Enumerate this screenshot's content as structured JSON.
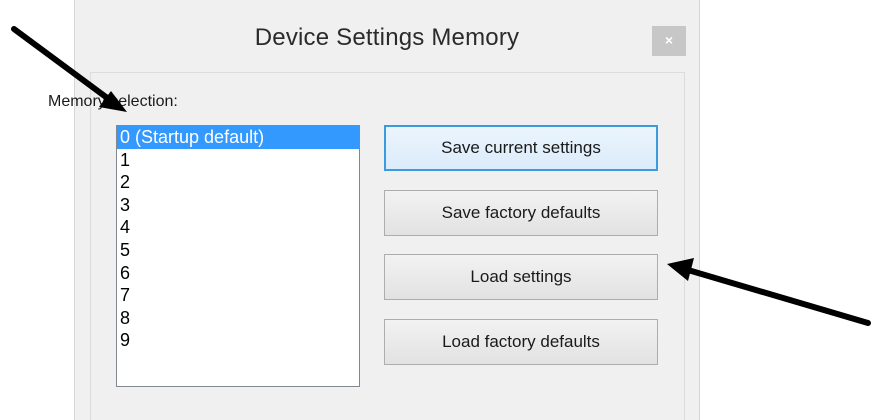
{
  "window": {
    "title": "Device Settings Memory",
    "close_glyph": "×"
  },
  "memory_label": "Memory selection:",
  "list_items": [
    "0 (Startup default)",
    "1",
    "2",
    "3",
    "4",
    "5",
    "6",
    "7",
    "8",
    "9"
  ],
  "selected_index": 0,
  "buttons": {
    "save_current": "Save current settings",
    "save_factory": "Save factory defaults",
    "load_settings": "Load settings",
    "load_factory": "Load factory defaults"
  },
  "colors": {
    "selection": "#3399ff",
    "default_button_border": "#3c9bde",
    "annotation_arrow": "#000000"
  }
}
